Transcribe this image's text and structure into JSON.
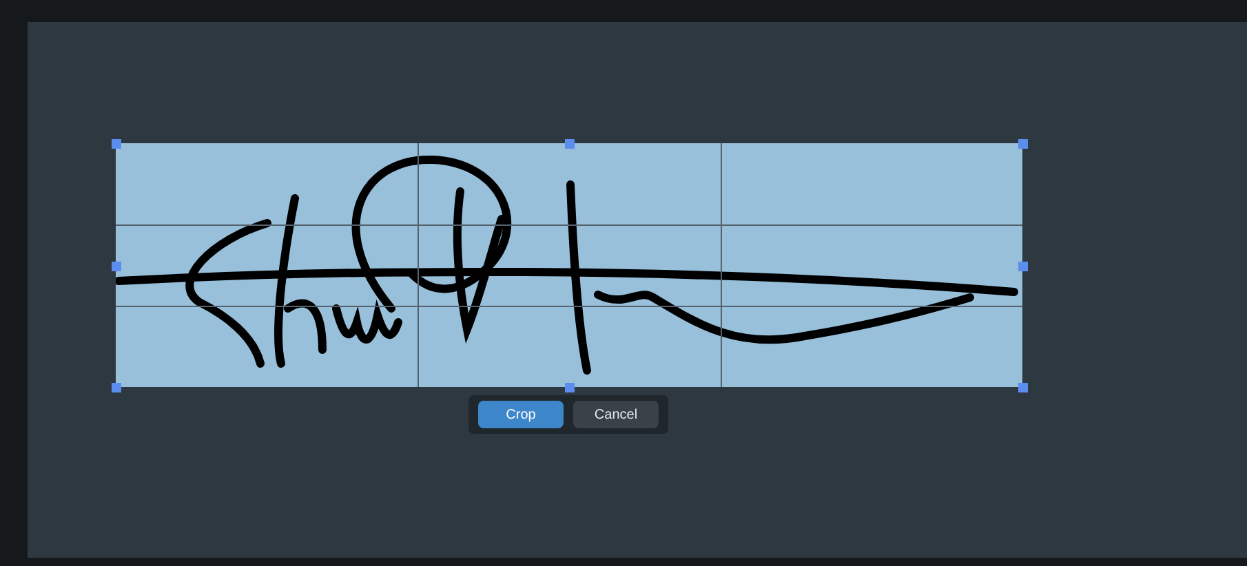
{
  "crop_toolbar": {
    "buttons": [
      {
        "label": "Crop",
        "kind": "primary"
      },
      {
        "label": "Cancel",
        "kind": "secondary"
      }
    ]
  }
}
